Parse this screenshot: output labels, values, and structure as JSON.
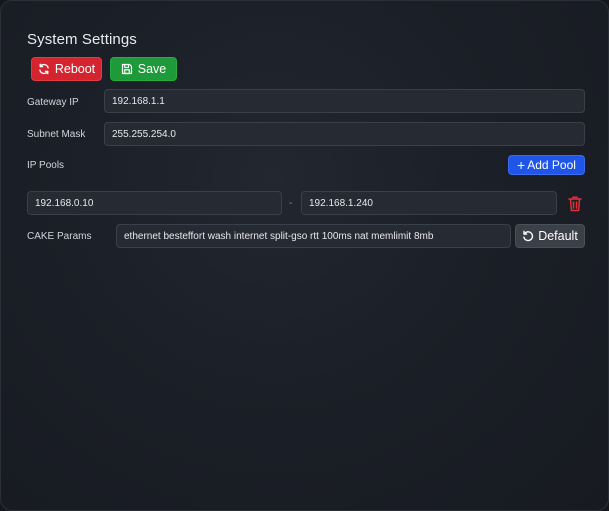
{
  "settings": {
    "title": "System Settings",
    "actions": {
      "reboot_label": "Reboot",
      "save_label": "Save"
    },
    "gateway": {
      "label": "Gateway IP",
      "value": "192.168.1.1"
    },
    "subnet": {
      "label": "Subnet Mask",
      "value": "255.255.254.0"
    },
    "ip_pools": {
      "label": "IP Pools",
      "add_label": "Add Pool",
      "add_icon": "plus-icon",
      "pools": [
        {
          "start": "192.168.0.10",
          "separator": "-",
          "end": "192.168.1.240",
          "delete_icon": "trash-icon"
        }
      ]
    },
    "cake": {
      "label": "CAKE Params",
      "value": "ethernet besteffort wash internet split-gso rtt 100ms  nat memlimit 8mb",
      "default_label": "Default",
      "default_icon": "reset-icon"
    }
  },
  "colors": {
    "reboot": "#d3242f",
    "save": "#1e9a3b",
    "add_pool": "#1f56e8",
    "delete_icon": "#e0303a",
    "default_button": "#3a3f48"
  }
}
